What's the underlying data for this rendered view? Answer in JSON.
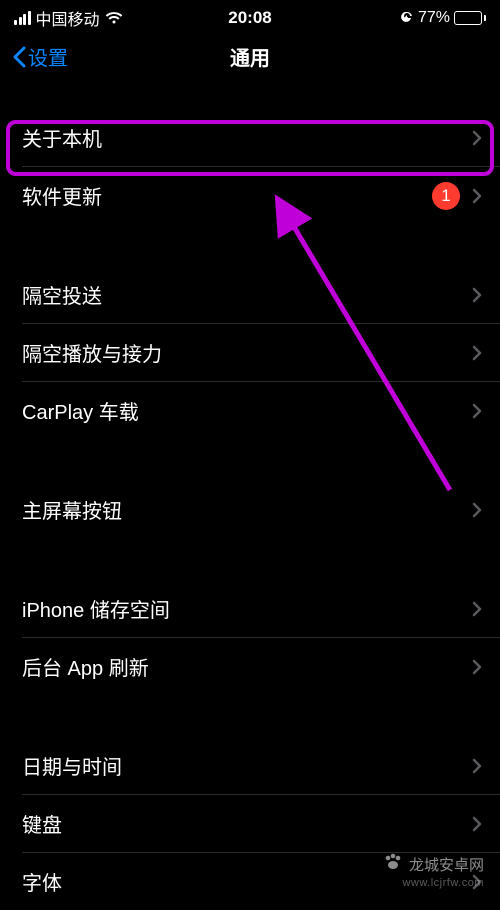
{
  "status": {
    "carrier": "中国移动",
    "time": "20:08",
    "battery_pct": "77%"
  },
  "nav": {
    "back_label": "设置",
    "title": "通用"
  },
  "groups": [
    {
      "rows": [
        {
          "label": "关于本机",
          "highlighted": true
        },
        {
          "label": "软件更新",
          "badge": "1"
        }
      ]
    },
    {
      "rows": [
        {
          "label": "隔空投送"
        },
        {
          "label": "隔空播放与接力"
        },
        {
          "label": "CarPlay 车载"
        }
      ]
    },
    {
      "rows": [
        {
          "label": "主屏幕按钮"
        }
      ]
    },
    {
      "rows": [
        {
          "label": "iPhone 储存空间"
        },
        {
          "label": "后台 App 刷新"
        }
      ]
    },
    {
      "rows": [
        {
          "label": "日期与时间"
        },
        {
          "label": "键盘"
        },
        {
          "label": "字体"
        }
      ]
    }
  ],
  "watermark": {
    "text": "龙城安卓网",
    "url": "www.lcjrfw.com"
  }
}
